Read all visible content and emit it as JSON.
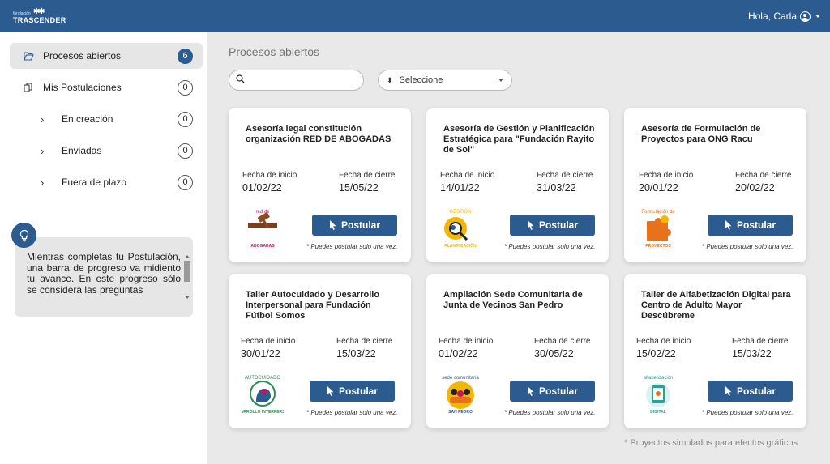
{
  "header": {
    "logo_small": "fundación",
    "logo_main": "TRASCENDER",
    "greeting": "Hola, Carla"
  },
  "sidebar": {
    "items": [
      {
        "label": "Procesos abiertos",
        "count": "6"
      },
      {
        "label": "Mis Postulaciones",
        "count": "0"
      },
      {
        "label": "En creación",
        "count": "0"
      },
      {
        "label": "Enviadas",
        "count": "0"
      },
      {
        "label": "Fuera de plazo",
        "count": "0"
      }
    ],
    "tip": "Mientras completas tu Postulación, una barra de progreso va midiento tu avance. En este progreso sólo se considera las preguntas"
  },
  "main": {
    "title": "Procesos abiertos",
    "search_placeholder": "",
    "select_value": "Seleccione",
    "start_label": "Fecha de inicio",
    "end_label": "Fecha de cierre",
    "apply_label": "Postular",
    "apply_note": "* Puedes postular solo una vez.",
    "footnote": "* Proyectos simulados para efectos gráficos"
  },
  "cards": [
    {
      "title": "Asesoría legal constitución organización RED DE ABOGADAS",
      "start": "01/02/22",
      "end": "15/05/22",
      "logo_icon": "gavel-icon",
      "logo_top": "red de",
      "logo_bottom": "ABOGADAS",
      "logo_color": "#c2185b"
    },
    {
      "title": "Asesoría de Gestión y Planificación Estratégica para \"Fundación Rayito de Sol\"",
      "start": "14/01/22",
      "end": "31/03/22",
      "logo_icon": "magnifier-icon",
      "logo_top": "GESTIÓN",
      "logo_bottom": "PLANIFICACIÓN",
      "logo_color": "#f2b705"
    },
    {
      "title": "Asesoría de Formulación de Proyectos para ONG Racu",
      "start": "20/01/22",
      "end": "20/02/22",
      "logo_icon": "puzzle-icon",
      "logo_top": "Formulación de",
      "logo_bottom": "PROYECTOS",
      "logo_color": "#e8711c"
    },
    {
      "title": "Taller Autocuidado y Desarrollo Interpersonal para Fundación Fútbol Somos",
      "start": "30/01/22",
      "end": "15/03/22",
      "logo_icon": "head-heart-icon",
      "logo_top": "AUTOCUIDADO",
      "logo_bottom": "y DESARROLLO INTERPERSONAL",
      "logo_color": "#2e8b57"
    },
    {
      "title": "Ampliación Sede Comunitaria de Junta de Vecinos San Pedro",
      "start": "01/02/22",
      "end": "30/05/22",
      "logo_icon": "community-icon",
      "logo_top": "sede comunitaria",
      "logo_bottom": "SAN PEDRO",
      "logo_color": "#2b5b8f"
    },
    {
      "title": "Taller de Alfabetización Digital para Centro de Adulto Mayor Descúbreme",
      "start": "15/02/22",
      "end": "15/03/22",
      "logo_icon": "tablet-icon",
      "logo_top": "alfabetización",
      "logo_bottom": "DIGITAL",
      "logo_color": "#2aa198"
    }
  ]
}
